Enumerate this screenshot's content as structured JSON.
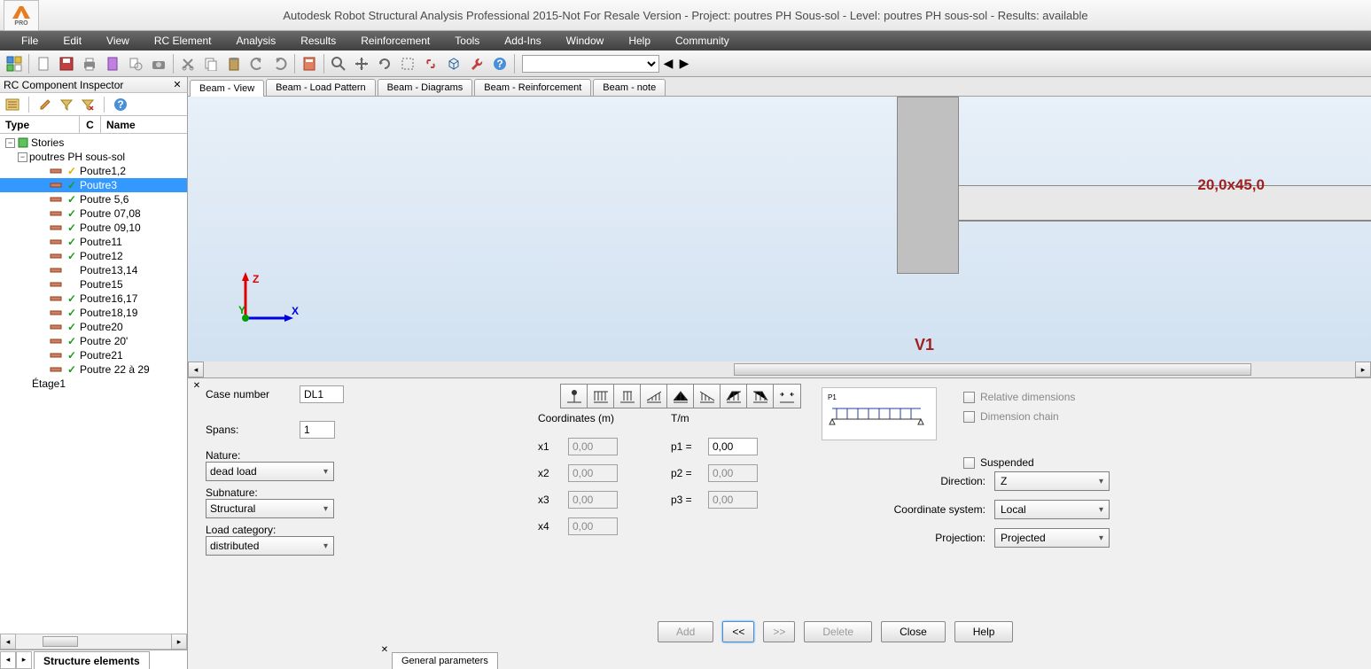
{
  "title": "Autodesk Robot Structural Analysis Professional 2015-Not For Resale Version - Project: poutres PH Sous-sol - Level: poutres PH sous-sol - Results: available",
  "app_icon_label": "PRO",
  "menu": [
    "File",
    "Edit",
    "View",
    "RC Element",
    "Analysis",
    "Results",
    "Reinforcement",
    "Tools",
    "Add-Ins",
    "Window",
    "Help",
    "Community"
  ],
  "inspector": {
    "title": "RC Component Inspector",
    "headers": {
      "type": "Type",
      "c": "C",
      "name": "Name"
    },
    "root": "Stories",
    "level": "poutres PH sous-sol",
    "items": [
      {
        "name": "Poutre1,2",
        "check": "yellow"
      },
      {
        "name": "Poutre3",
        "check": "green",
        "selected": true
      },
      {
        "name": "Poutre 5,6",
        "check": "green"
      },
      {
        "name": "Poutre 07,08",
        "check": "green"
      },
      {
        "name": "Poutre 09,10",
        "check": "green"
      },
      {
        "name": "Poutre11",
        "check": "green"
      },
      {
        "name": "Poutre12",
        "check": "green"
      },
      {
        "name": "Poutre13,14",
        "check": ""
      },
      {
        "name": "Poutre15",
        "check": ""
      },
      {
        "name": "Poutre16,17",
        "check": "green"
      },
      {
        "name": "Poutre18,19",
        "check": "green"
      },
      {
        "name": "Poutre20",
        "check": "green"
      },
      {
        "name": "Poutre 20'",
        "check": "green"
      },
      {
        "name": "Poutre21",
        "check": "green"
      },
      {
        "name": "Poutre 22 à 29",
        "check": "green"
      }
    ],
    "etage": "Étage1",
    "tab": "Structure elements"
  },
  "view_tabs": [
    "Beam - View",
    "Beam - Load Pattern",
    "Beam - Diagrams",
    "Beam - Reinforcement",
    "Beam - note"
  ],
  "viewport": {
    "dim_label": "20,0x45,0",
    "v_label": "V1",
    "axes": {
      "x": "X",
      "y": "Y",
      "z": "Z"
    }
  },
  "panel": {
    "case_number_label": "Case number",
    "case_number": "DL1",
    "spans_label": "Spans:",
    "spans": "1",
    "nature_label": "Nature:",
    "nature": "dead load",
    "subnature_label": "Subnature:",
    "subnature": "Structural",
    "load_cat_label": "Load category:",
    "load_cat": "distributed",
    "coords_label": "Coordinates (m)",
    "x1_label": "x1",
    "x1": "0,00",
    "x2_label": "x2",
    "x2": "0,00",
    "x3_label": "x3",
    "x3": "0,00",
    "x4_label": "x4",
    "x4": "0,00",
    "tm_label": "T/m",
    "p1_label": "p1 =",
    "p1": "0,00",
    "p2_label": "p2 =",
    "p2": "0,00",
    "p3_label": "p3 =",
    "p3": "0,00",
    "diagram_label": "P1",
    "rel_dim": "Relative dimensions",
    "dim_chain": "Dimension chain",
    "suspended": "Suspended",
    "direction_label": "Direction:",
    "direction": "Z",
    "coord_sys_label": "Coordinate system:",
    "coord_sys": "Local",
    "projection_label": "Projection:",
    "projection": "Projected",
    "btn_add": "Add",
    "btn_prev": "<<",
    "btn_next": ">>",
    "btn_delete": "Delete",
    "btn_close": "Close",
    "btn_help": "Help",
    "general_params": "General parameters"
  }
}
